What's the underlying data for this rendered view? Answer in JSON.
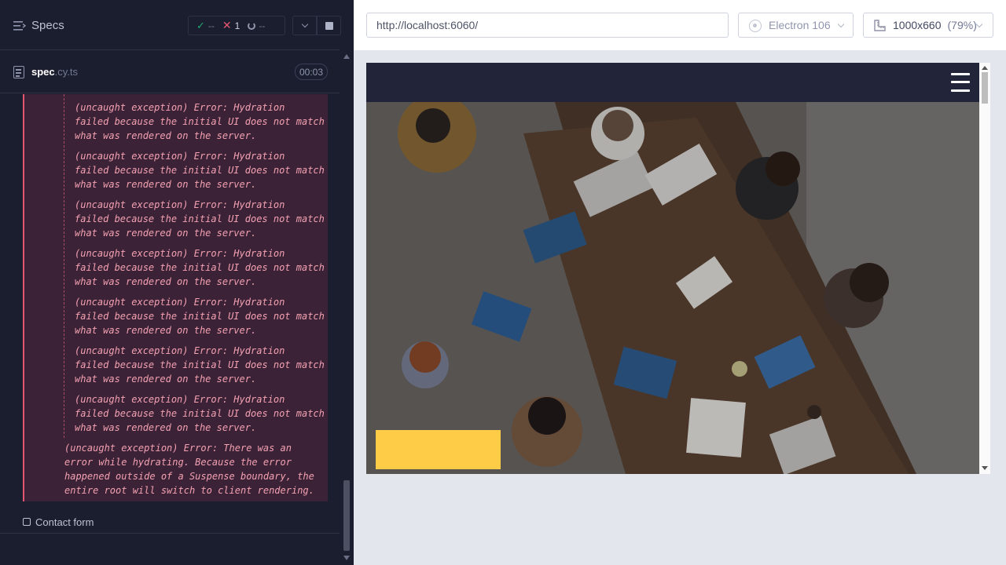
{
  "reporter": {
    "title": "Specs",
    "stats": {
      "passed": "--",
      "failed": "1",
      "pending": "--"
    },
    "spec": {
      "name": "spec",
      "ext": ".cy.ts",
      "duration": "00:03"
    },
    "nested_errors": [
      "(uncaught exception)  Error: Hydration\nfailed because the initial UI does not match\nwhat was rendered on the server.",
      "(uncaught exception)  Error: Hydration\nfailed because the initial UI does not match\nwhat was rendered on the server.",
      "(uncaught exception)  Error: Hydration\nfailed because the initial UI does not match\nwhat was rendered on the server.",
      "(uncaught exception)  Error: Hydration\nfailed because the initial UI does not match\nwhat was rendered on the server.",
      "(uncaught exception)  Error: Hydration\nfailed because the initial UI does not match\nwhat was rendered on the server.",
      "(uncaught exception)  Error: Hydration\nfailed because the initial UI does not match\nwhat was rendered on the server.",
      "(uncaught exception)  Error: Hydration\nfailed because the initial UI does not match\nwhat was rendered on the server."
    ],
    "outer_error": "(uncaught exception)  Error: There was an\nerror while hydrating. Because the error\nhappened outside of a Suspense boundary, the\nentire root will switch to client rendering.",
    "test_label": "Contact form"
  },
  "aut": {
    "url": "http://localhost:6060/",
    "browser": "Electron 106",
    "viewport": "1000x660",
    "zoom": "(79%)"
  },
  "colors": {
    "accent_fail": "#e45770",
    "accent_pass": "#1fa971",
    "cta": "#ffcc47"
  }
}
